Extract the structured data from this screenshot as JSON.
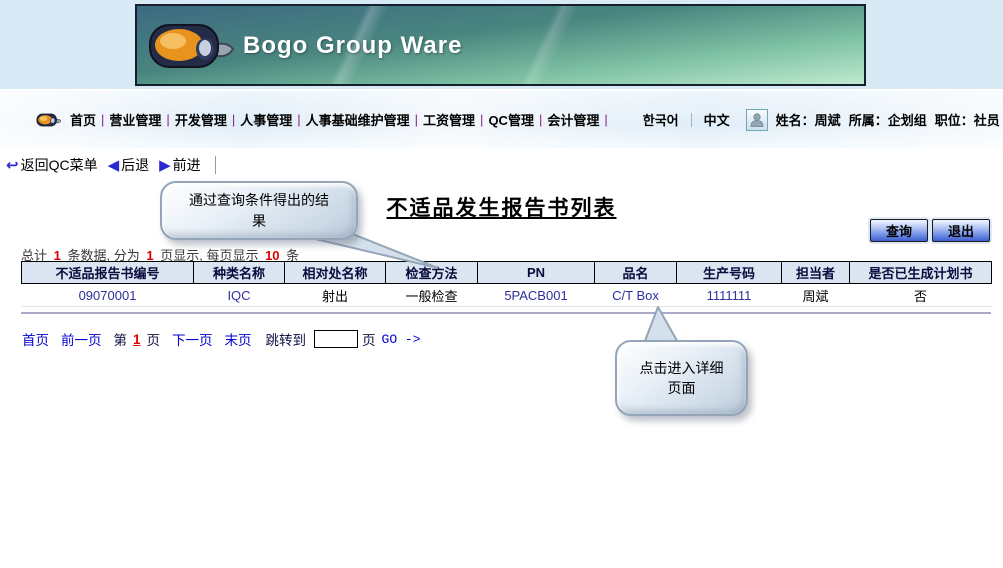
{
  "banner": {
    "title": "Bogo Group Ware"
  },
  "nav": {
    "items": [
      "首页",
      "营业管理",
      "开发管理",
      "人事管理",
      "人事基础维护管理",
      "工资管理",
      "QC管理",
      "会计管理"
    ],
    "languages": [
      "한국어",
      "中文"
    ],
    "user": {
      "name_label": "姓名：",
      "name": "周斌",
      "dept_label": "所属：",
      "dept": "企划组",
      "title_label": "职位：",
      "title": "社员"
    }
  },
  "toolbar": {
    "back_menu": "返回QC菜单",
    "back": "后退",
    "forward": "前进",
    "return_icon": "return-arrow-icon",
    "back_icon": "left-arrow-icon",
    "forward_icon": "right-arrow-icon"
  },
  "page": {
    "title": "不适品发生报告书列表"
  },
  "buttons": {
    "search": "查询",
    "exit": "退出"
  },
  "callouts": {
    "result": "通过查询条件得出的结果",
    "detail": "点击进入详细页面"
  },
  "summary": {
    "prefix": "总计",
    "count": "1",
    "mid1": "条数据, 分为",
    "pages": "1",
    "mid2": "页显示, 每页显示",
    "per_page": "10",
    "suffix": "条"
  },
  "table": {
    "headers": [
      "不适品报告书编号",
      "种类名称",
      "相对处名称",
      "检查方法",
      "PN",
      "品名",
      "生产号码",
      "担当者",
      "是否已生成计划书"
    ],
    "rows": [
      [
        "09070001",
        "IQC",
        "射出",
        "一般检查",
        "5PACB001",
        "C/T Box",
        "1111111",
        "周斌",
        "否"
      ]
    ],
    "value_colors": [
      "#2f2f9e",
      "#2f2f9e",
      "#000000",
      "#000000",
      "#2f2f9e",
      "#2f2f9e",
      "#2f2f9e",
      "#000000",
      "#000000"
    ]
  },
  "pagination": {
    "first": "首页",
    "prev": "前一页",
    "page_prefix": "第",
    "current": "1",
    "page_suffix": "页",
    "next": "下一页",
    "last": "末页",
    "jump_label": "跳转到",
    "jump_value": "",
    "jump_suffix": "页",
    "go": "GO ->"
  },
  "colors": {
    "link_blue": "#0000d0",
    "highlight_red": "#e00000",
    "value_navy": "#2f2f9e",
    "table_header_bg": "#dbe5f1",
    "nav_separator_purple": "#8a1f8a",
    "banner_top": "#3c6a82",
    "banner_bottom": "#bfe9cf",
    "top_strip_blue": "#d7eaf6",
    "button_blue": "#3f5fd0"
  }
}
